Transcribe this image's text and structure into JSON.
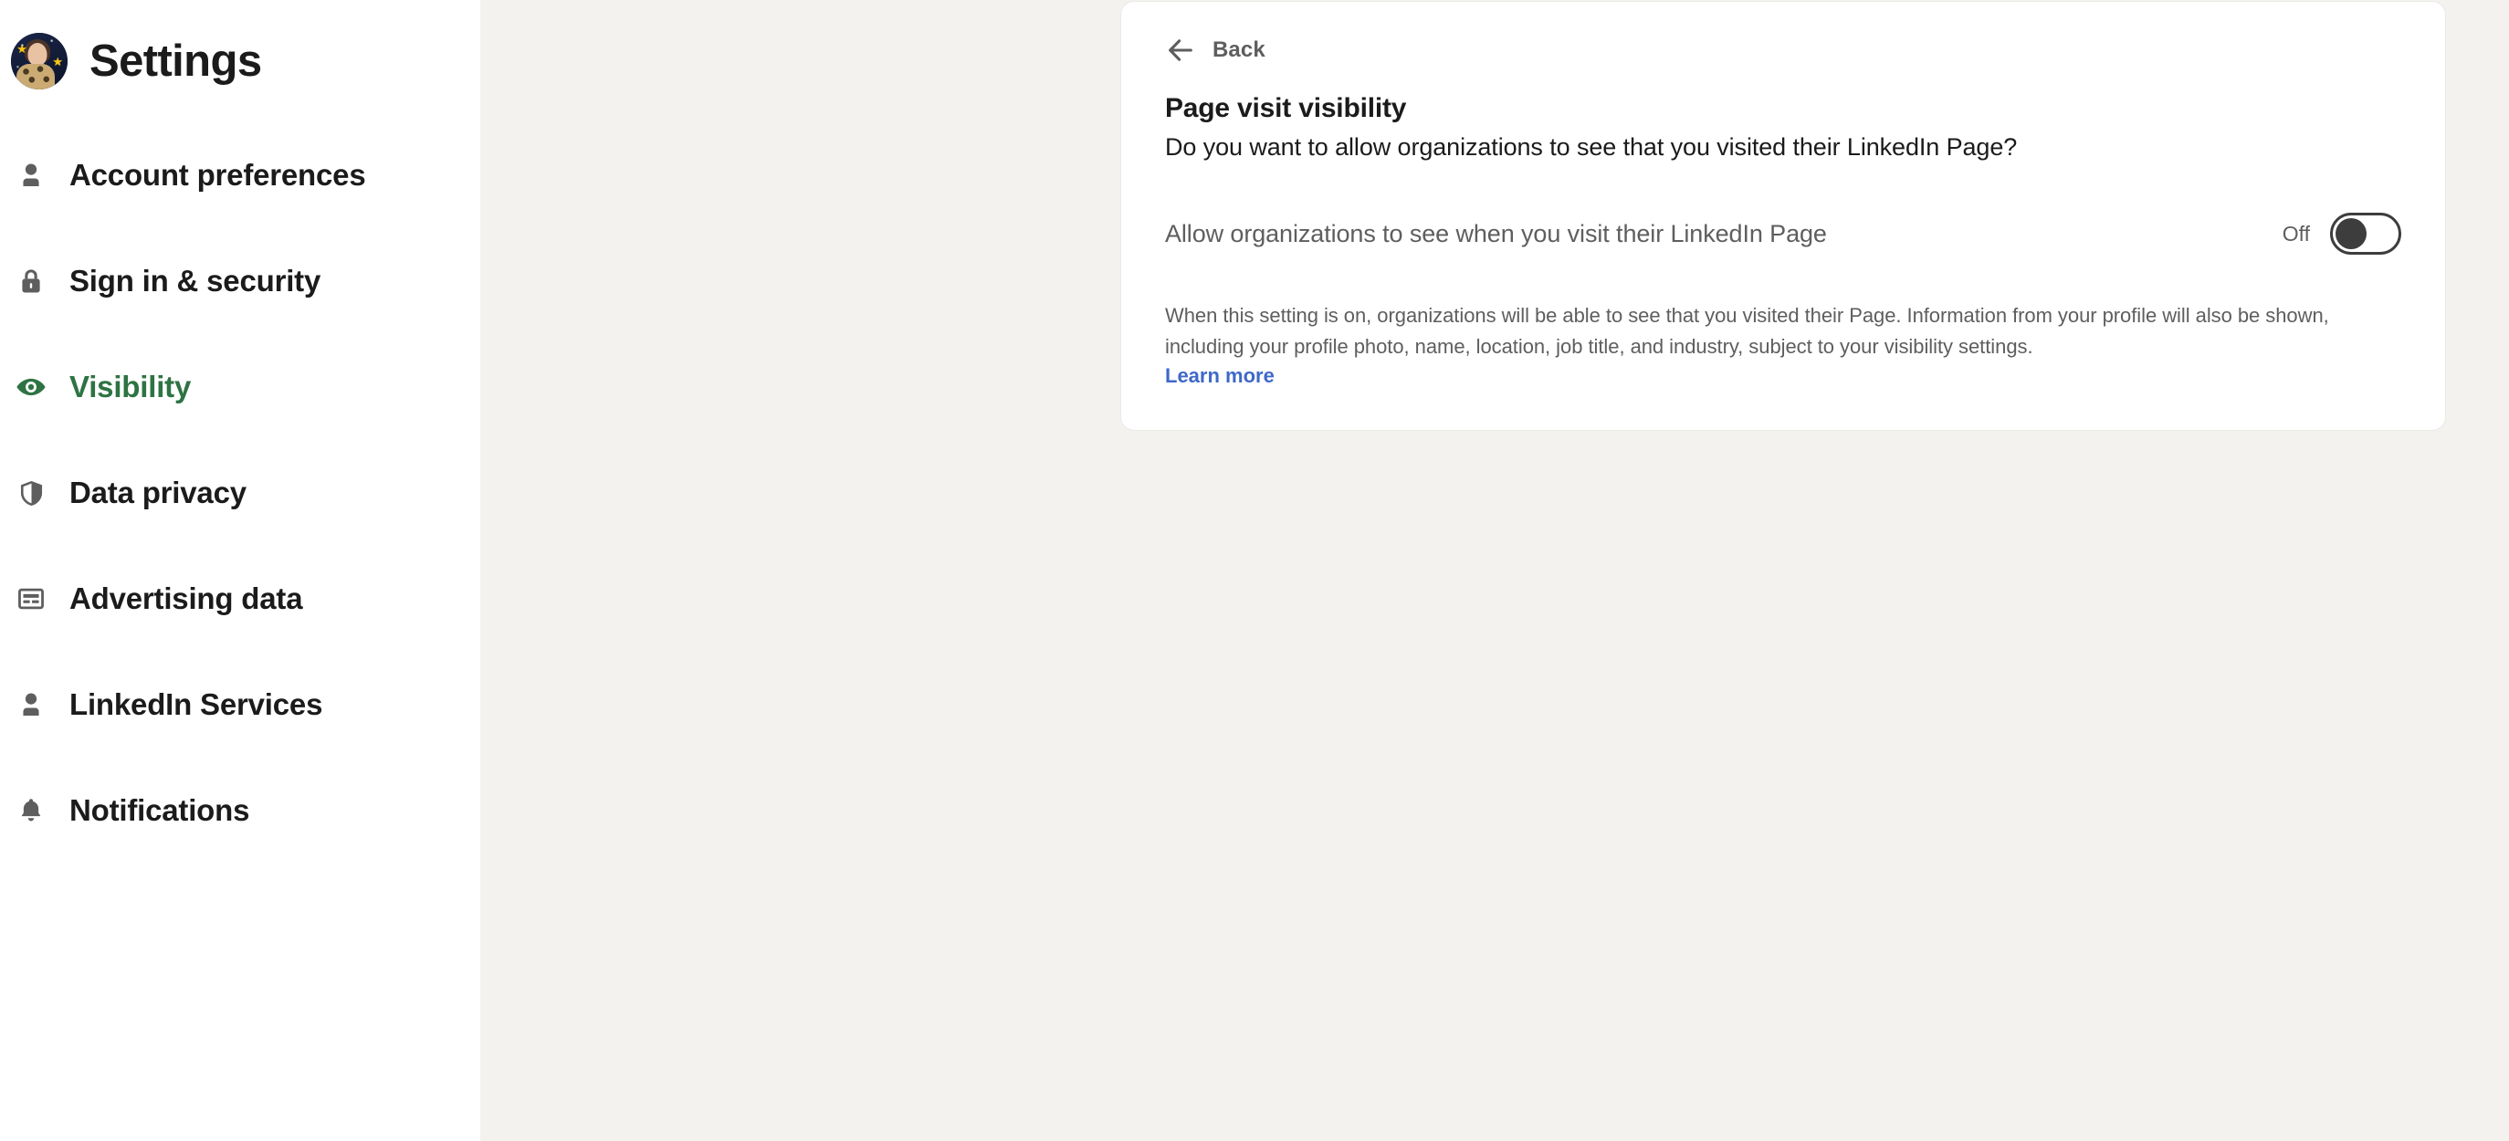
{
  "theme": {
    "page_background": "#f3f2ef",
    "sidebar_background": "#ffffff",
    "card_background": "#ffffff",
    "accent_active": "#2e7343",
    "link_color": "#3f68c8",
    "muted_text": "#5e5e5e",
    "primary_text": "#1b1b1b",
    "toggle_color": "#3d3d3d"
  },
  "sidebar": {
    "title": "Settings",
    "avatar_name": "profile-avatar",
    "items": [
      {
        "label": "Account preferences",
        "icon": "person-icon",
        "active": false
      },
      {
        "label": "Sign in & security",
        "icon": "lock-icon",
        "active": false
      },
      {
        "label": "Visibility",
        "icon": "eye-icon",
        "active": true
      },
      {
        "label": "Data privacy",
        "icon": "shield-icon",
        "active": false
      },
      {
        "label": "Advertising data",
        "icon": "ad-card-icon",
        "active": false
      },
      {
        "label": "LinkedIn Services",
        "icon": "person-icon",
        "active": false
      },
      {
        "label": "Notifications",
        "icon": "bell-icon",
        "active": false
      }
    ]
  },
  "card": {
    "back_label": "Back",
    "back_icon": "arrow-left-icon",
    "title": "Page visit visibility",
    "subtitle": "Do you want to allow organizations to see that you visited their LinkedIn Page?",
    "setting": {
      "label": "Allow organizations to see when you visit their LinkedIn Page",
      "state_label": "Off",
      "state_on": false
    },
    "description": "When this setting is on, organizations will be able to see that you visited their Page. Information from your profile will also be shown, including your profile photo, name, location, job title, and industry, subject to your visibility settings.",
    "learn_more_label": "Learn more"
  }
}
